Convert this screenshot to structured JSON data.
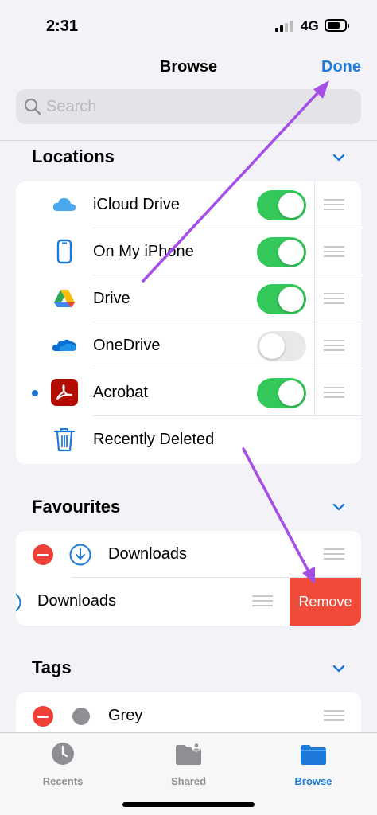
{
  "status": {
    "time": "2:31",
    "network": "4G"
  },
  "nav": {
    "title": "Browse",
    "done_label": "Done"
  },
  "search": {
    "placeholder": "Search"
  },
  "locations": {
    "header": "Locations",
    "items": [
      {
        "label": "iCloud Drive",
        "icon": "icloud-icon",
        "toggle": true
      },
      {
        "label": "On My iPhone",
        "icon": "iphone-icon",
        "toggle": true
      },
      {
        "label": "Drive",
        "icon": "google-drive-icon",
        "toggle": true
      },
      {
        "label": "OneDrive",
        "icon": "onedrive-icon",
        "toggle": false
      },
      {
        "label": "Acrobat",
        "icon": "acrobat-icon",
        "toggle": true
      },
      {
        "label": "Recently Deleted",
        "icon": "trash-icon"
      }
    ]
  },
  "favourites": {
    "header": "Favourites",
    "items": [
      {
        "label": "Downloads",
        "icon": "download-icon"
      },
      {
        "label": "Downloads",
        "remove_label": "Remove"
      }
    ]
  },
  "tags": {
    "header": "Tags",
    "items": [
      {
        "label": "Grey",
        "color": "#8e8e93"
      }
    ]
  },
  "tabbar": {
    "tabs": [
      {
        "label": "Recents",
        "icon": "clock-icon"
      },
      {
        "label": "Shared",
        "icon": "shared-folder-icon"
      },
      {
        "label": "Browse",
        "icon": "folder-icon",
        "active": true
      }
    ]
  },
  "colors": {
    "accent": "#1e7ad8",
    "toggle_on": "#34c759",
    "destructive": "#f04a3a",
    "annotation_arrow": "#a64ee8"
  }
}
